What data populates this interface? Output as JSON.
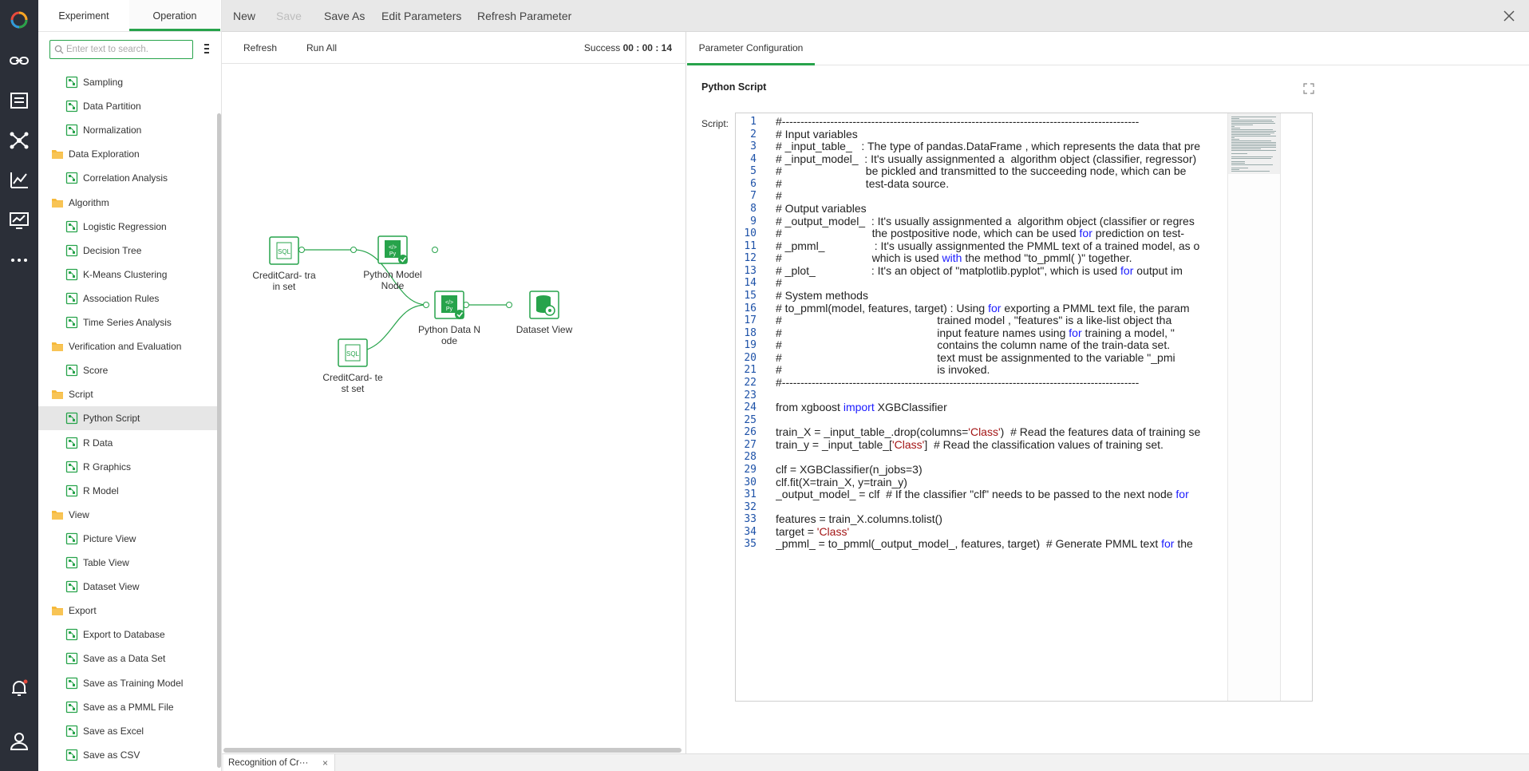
{
  "panel": {
    "tabs": [
      "Experiment",
      "Operation"
    ],
    "search_placeholder": "Enter text to search.",
    "tree": [
      {
        "label": "Sampling",
        "kind": "leaf"
      },
      {
        "label": "Data Partition",
        "kind": "leaf"
      },
      {
        "label": "Normalization",
        "kind": "leaf"
      },
      {
        "label": "Data Exploration",
        "kind": "folder"
      },
      {
        "label": "Correlation Analysis",
        "kind": "leaf"
      },
      {
        "label": "Algorithm",
        "kind": "folder"
      },
      {
        "label": "Logistic Regression",
        "kind": "leaf"
      },
      {
        "label": "Decision Tree",
        "kind": "leaf"
      },
      {
        "label": "K-Means Clustering",
        "kind": "leaf"
      },
      {
        "label": "Association Rules",
        "kind": "leaf"
      },
      {
        "label": "Time Series Analysis",
        "kind": "leaf"
      },
      {
        "label": "Verification and Evaluation",
        "kind": "folder"
      },
      {
        "label": "Score",
        "kind": "leaf"
      },
      {
        "label": "Script",
        "kind": "folder"
      },
      {
        "label": "Python Script",
        "kind": "leaf",
        "selected": true
      },
      {
        "label": "R Data",
        "kind": "leaf"
      },
      {
        "label": "R Graphics",
        "kind": "leaf"
      },
      {
        "label": "R Model",
        "kind": "leaf"
      },
      {
        "label": "View",
        "kind": "folder"
      },
      {
        "label": "Picture View",
        "kind": "leaf"
      },
      {
        "label": "Table View",
        "kind": "leaf"
      },
      {
        "label": "Dataset View",
        "kind": "leaf"
      },
      {
        "label": "Export",
        "kind": "folder"
      },
      {
        "label": "Export to Database",
        "kind": "leaf"
      },
      {
        "label": "Save as a Data Set",
        "kind": "leaf"
      },
      {
        "label": "Save as Training Model",
        "kind": "leaf"
      },
      {
        "label": "Save as a PMML File",
        "kind": "leaf"
      },
      {
        "label": "Save as Excel",
        "kind": "leaf"
      },
      {
        "label": "Save as CSV",
        "kind": "leaf"
      }
    ]
  },
  "toolbar": {
    "new": "New",
    "save": "Save",
    "save_as": "Save As",
    "edit_parameters": "Edit Parameters",
    "refresh_parameter": "Refresh Parameter"
  },
  "canvas": {
    "refresh": "Refresh",
    "run_all": "Run All",
    "status_label": "Success",
    "status_time": "00 : 00 : 14",
    "nodes": {
      "train": [
        "CreditCard- tra",
        "in set"
      ],
      "test": [
        "CreditCard- te",
        "st set"
      ],
      "model": [
        "Python Model",
        "Node"
      ],
      "data": [
        "Python Data N",
        "ode"
      ],
      "view": [
        "Dataset View"
      ]
    }
  },
  "bottom": {
    "doc_tab": "Recognition of Cr···",
    "close": "×"
  },
  "config": {
    "tab": "Parameter Configuration",
    "title": "Python Script",
    "script_label": "Script:",
    "code_lines": [
      "#------------------------------------------------------------------------------------------------",
      "# Input variables",
      "# _input_table_   : The type of pandas.DataFrame , which represents the data that pre",
      "# _input_model_  : It's usually assignmented a  algorithm object (classifier, regressor)",
      "#                           be pickled and transmitted to the succeeding node, which can be",
      "#                           test-data source.",
      "#",
      "# Output variables",
      "# _output_model_  : It's usually assignmented a  algorithm object (classifier or regres",
      "#                             the postpositive node, which can be used for prediction on test-",
      "# _pmml_                : It's usually assignmented the PMML text of a trained model, as o",
      "#                             which is used with the method \"to_pmml( )\" together.",
      "# _plot_                  : It's an object of \"matplotlib.pyplot\", which is used for output im",
      "#",
      "# System methods",
      "# to_pmml(model, features, target) : Using for exporting a PMML text file, the param",
      "#                                                  trained model , \"features\" is a like-list object tha",
      "#                                                  input feature names using for training a model, \"",
      "#                                                  contains the column name of the train-data set.",
      "#                                                  text must be assignmented to the variable \"_pmi",
      "#                                                  is invoked.",
      "#------------------------------------------------------------------------------------------------",
      "",
      "from xgboost import XGBClassifier",
      "",
      "train_X = _input_table_.drop(columns='Class')  # Read the features data of training se",
      "train_y = _input_table_['Class']  # Read the classification values of training set.",
      "",
      "clf = XGBClassifier(n_jobs=3)",
      "clf.fit(X=train_X, y=train_y)",
      "_output_model_ = clf  # If the classifier \"clf\" needs to be passed to the next node for",
      "",
      "features = train_X.columns.tolist()",
      "target = 'Class'",
      "_pmml_ = to_pmml(_output_model_, features, target)  # Generate PMML text for the"
    ]
  },
  "colors": {
    "accent": "#27a34b",
    "rail": "#2b2f38",
    "line_number": "#1e52a8",
    "keyword": "#1a1aff",
    "string": "#a31515",
    "comment": "#222222"
  }
}
